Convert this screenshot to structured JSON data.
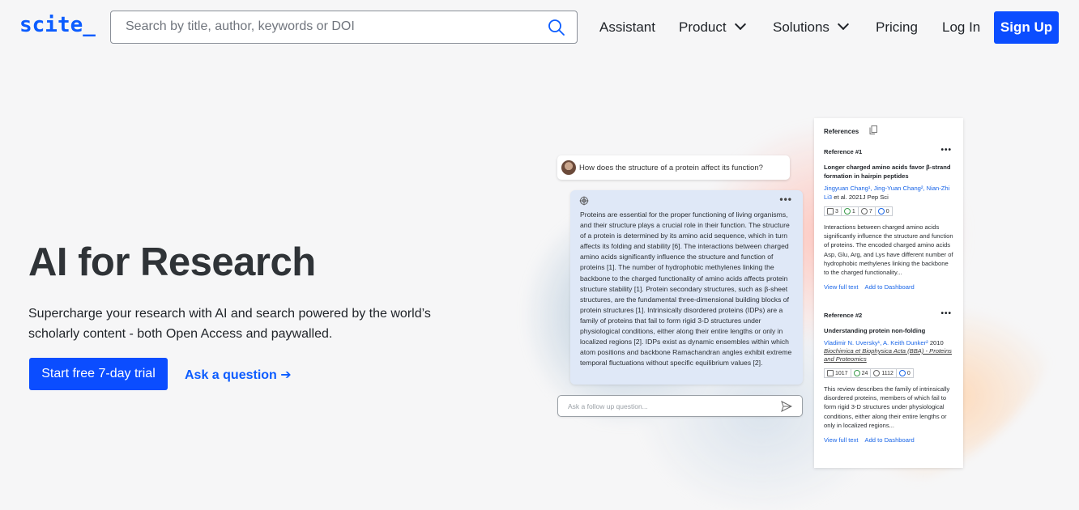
{
  "nav": {
    "logo": "scite_",
    "search_placeholder": "Search by title, author, keywords or DOI",
    "links": [
      "Assistant",
      "Product",
      "Solutions",
      "Pricing",
      "Log In"
    ],
    "signup": "Sign Up"
  },
  "hero": {
    "title": "AI for Research",
    "subtitle": "Supercharge your research with AI and search powered by the world’s scholarly content - both Open Access and paywalled.",
    "cta_primary": "Start free 7-day trial",
    "cta_secondary": "Ask a question ➔"
  },
  "chat": {
    "question": "How does the structure of a protein affect its function?",
    "answer_menu": "•••",
    "answer": "Proteins are essential for the proper functioning of living organisms, and their structure plays a crucial role in their function. The structure of a protein is determined by its amino acid sequence, which in turn affects its folding and stability [6]. The interactions between charged amino acids significantly influence the structure and function of proteins [1]. The number of hydrophobic methylenes linking the backbone to the charged functionality of amino acids affects protein structure stability [1]. Protein secondary structures, such as β-sheet structures, are the fundamental three-dimensional building blocks of protein structures [1]. Intrinsically disordered proteins (IDPs) are a family of proteins that fail to form rigid 3-D structures under physiological conditions, either along their entire lengths or only in localized regions [2]. IDPs exist as dynamic ensembles within which atom positions and backbone Ramachandran angles exhibit extreme temporal fluctuations without specific equilibrium values [2].",
    "followup_placeholder": "Ask a follow up question..."
  },
  "references": {
    "header": "References",
    "items": [
      {
        "num": "Reference #1",
        "menu": "•••",
        "title": "Longer charged amino acids favor β-strand formation in hairpin peptides",
        "authors": "Jingyuan Chang¹, Jing-Yuan Chang², Nian-Zhi Li3",
        "meta": " et al. 2021J Pep Sci",
        "journal": "",
        "stats": [
          "3",
          "1",
          "7",
          "0"
        ],
        "snippet": "Interactions between charged amino acids significantly influence the structure and function of proteins. The encoded charged amino acids Asp, Glu, Arg, and Lys have different number of hydrophobic methylenes linking the backbone to the charged functionality...",
        "view": "View full text",
        "add": "Add to Dashboard"
      },
      {
        "num": "Reference #2",
        "menu": "•••",
        "title": "Understanding protein non-folding",
        "authors": "Vladimir N. Uversky¹, A. Keith Dunker²",
        "meta": " 2010",
        "journal": "Biochimica et Biophysica Acta (BBA) - Proteins and Proteomics",
        "stats": [
          "1017",
          "24",
          "1112",
          "0"
        ],
        "snippet": "This review describes the family of intrinsically disordered proteins, members of which fail to form rigid 3-D structures under physiological conditions, either along their entire lengths or only in localized regions...",
        "view": "View full text",
        "add": "Add to Dashboard"
      }
    ]
  },
  "colors": {
    "brand": "#0b4dff",
    "link": "#1a66e8"
  }
}
